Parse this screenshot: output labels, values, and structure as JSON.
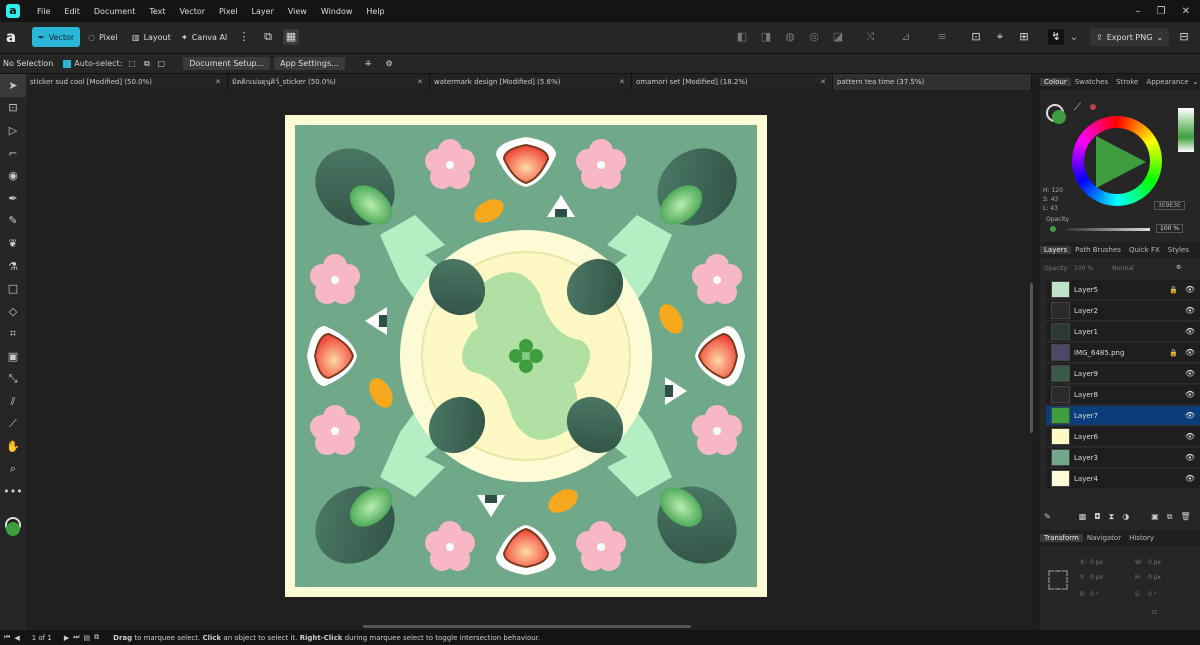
{
  "menubar": {
    "items": [
      "File",
      "Edit",
      "Document",
      "Text",
      "Vector",
      "Pixel",
      "Layer",
      "View",
      "Window",
      "Help"
    ]
  },
  "toolbar": {
    "personas": [
      "Vector",
      "Pixel",
      "Layout",
      "Canva AI"
    ],
    "export_label": "Export PNG"
  },
  "context": {
    "selection": "No Selection",
    "autoselect_label": "Auto-select:",
    "document_setup": "Document Setup...",
    "app_settings": "App Settings..."
  },
  "tabs": [
    {
      "label": "sticker sud cool [Modified] (50.0%)"
    },
    {
      "label": "มิตติกเม่อดุนุคิว์_sticker (50.0%)"
    },
    {
      "label": "watermark design [Modified] (5.6%)"
    },
    {
      "label": "omamori set [Modified] (18.2%)"
    },
    {
      "label": "pattern tea time (37.5%)"
    }
  ],
  "colour_panel": {
    "tabs": [
      "Colour",
      "Swatches",
      "Stroke",
      "Appearance"
    ],
    "h": "H: 120",
    "s": "S: 43",
    "l": "L: 43",
    "hex": "3E9E3E",
    "opacity_label": "Opacity",
    "opacity_value": "100 %",
    "colors": {
      "fill": "#3e9e3e",
      "accent": "#29b6d8"
    }
  },
  "layers_panel": {
    "tabs": [
      "Layers",
      "Path Brushes",
      "Quick FX",
      "Styles"
    ],
    "opacity_label": "Opacity:",
    "opacity_value": "100 %",
    "blend_mode": "Normal",
    "layers": [
      {
        "name": "Layer5",
        "locked": true
      },
      {
        "name": "Layer2",
        "locked": false
      },
      {
        "name": "Layer1",
        "locked": false
      },
      {
        "name": "IMG_6485.png",
        "locked": true
      },
      {
        "name": "Layer9",
        "locked": false
      },
      {
        "name": "Layer8",
        "locked": false
      },
      {
        "name": "Layer7",
        "locked": false,
        "selected": true
      },
      {
        "name": "Layer6",
        "locked": false
      },
      {
        "name": "Layer3",
        "locked": false
      },
      {
        "name": "Layer4",
        "locked": false
      }
    ]
  },
  "transform_panel": {
    "tabs": [
      "Transform",
      "Navigator",
      "History"
    ],
    "x_label": "X:",
    "x": "0 px",
    "y_label": "Y:",
    "y": "0 px",
    "w_label": "W:",
    "w": "0 px",
    "h_label": "H:",
    "h": "0 px",
    "r_label": "R:",
    "r": "0 °",
    "s_label": "S:",
    "s": "0 °"
  },
  "status": {
    "page": "1 of 1",
    "hint_drag": "Drag",
    "hint_1": " to marquee select. ",
    "hint_click": "Click",
    "hint_2": " an object to select it. ",
    "hint_right": "Right-Click",
    "hint_3": " during marquee select to toggle intersection behaviour."
  }
}
